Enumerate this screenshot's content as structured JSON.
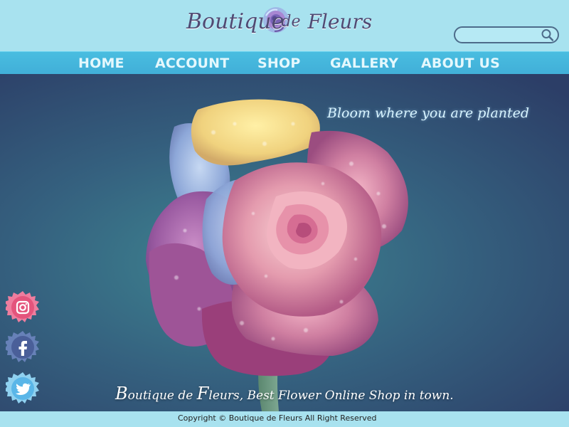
{
  "header": {
    "logo_text": {
      "part1": "Boutique",
      "part2": "de",
      "part3": "Fleurs"
    },
    "search": {
      "value": "",
      "placeholder": "",
      "icon": "search-icon"
    }
  },
  "nav": {
    "items": [
      {
        "label": "HOME"
      },
      {
        "label": "ACCOUNT"
      },
      {
        "label": "SHOP"
      },
      {
        "label": "GALLERY"
      },
      {
        "label": "ABOUT US"
      }
    ]
  },
  "hero": {
    "tagline": "Bloom where you are planted",
    "bottom_text": {
      "big1": "B",
      "rest1": "outique de ",
      "big2": "F",
      "rest2": "leurs, Best Flower Online Shop in town."
    }
  },
  "social": {
    "items": [
      {
        "icon": "instagram-icon"
      },
      {
        "icon": "facebook-icon"
      },
      {
        "icon": "twitter-icon"
      }
    ]
  },
  "footer": {
    "copyright": "Copyright © Boutique de Fleurs All Right Reserved"
  },
  "colors": {
    "header_bg": "#a8e2ef",
    "nav_bg": "#45b6dc",
    "nav_text": "#e4f8fd",
    "logo_text": "#4f4a73",
    "hero_bg_center": "#3e8691",
    "hero_bg_edge": "#2c3e67",
    "tagline_text": "#d8f4ff",
    "footer_text": "#232323"
  }
}
